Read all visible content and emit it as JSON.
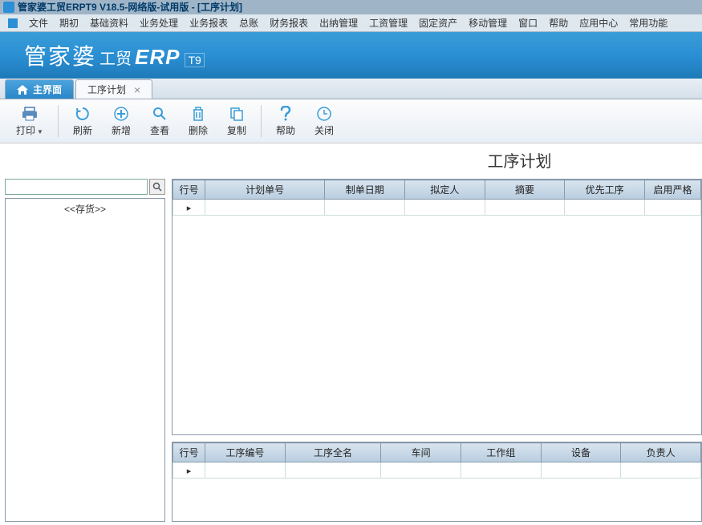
{
  "window": {
    "title": "管家婆工贸ERPT9 V18.5-网络版-试用版 - [工序计划]"
  },
  "menu": {
    "items": [
      "文件",
      "期初",
      "基础资料",
      "业务处理",
      "业务报表",
      "总账",
      "财务报表",
      "出纳管理",
      "工资管理",
      "固定资产",
      "移动管理",
      "窗口",
      "帮助",
      "应用中心",
      "常用功能"
    ]
  },
  "brand": {
    "main": "管家婆",
    "sub": "工贸",
    "erp": "ERP",
    "t9": "T9"
  },
  "tabs": {
    "home": "主界面",
    "active": "工序计划"
  },
  "toolbar": {
    "print": "打印",
    "refresh": "刷新",
    "add": "新增",
    "view": "查看",
    "delete": "删除",
    "copy": "复制",
    "help": "帮助",
    "close": "关闭"
  },
  "page": {
    "title": "工序计划"
  },
  "sidebar": {
    "search_placeholder": "",
    "tree_root": "<<存货>>"
  },
  "grid_top": {
    "columns": [
      "行号",
      "计划单号",
      "制单日期",
      "拟定人",
      "摘要",
      "优先工序",
      "启用严格"
    ]
  },
  "grid_bottom": {
    "columns": [
      "行号",
      "工序编号",
      "工序全名",
      "车间",
      "工作组",
      "设备",
      "负责人"
    ]
  }
}
